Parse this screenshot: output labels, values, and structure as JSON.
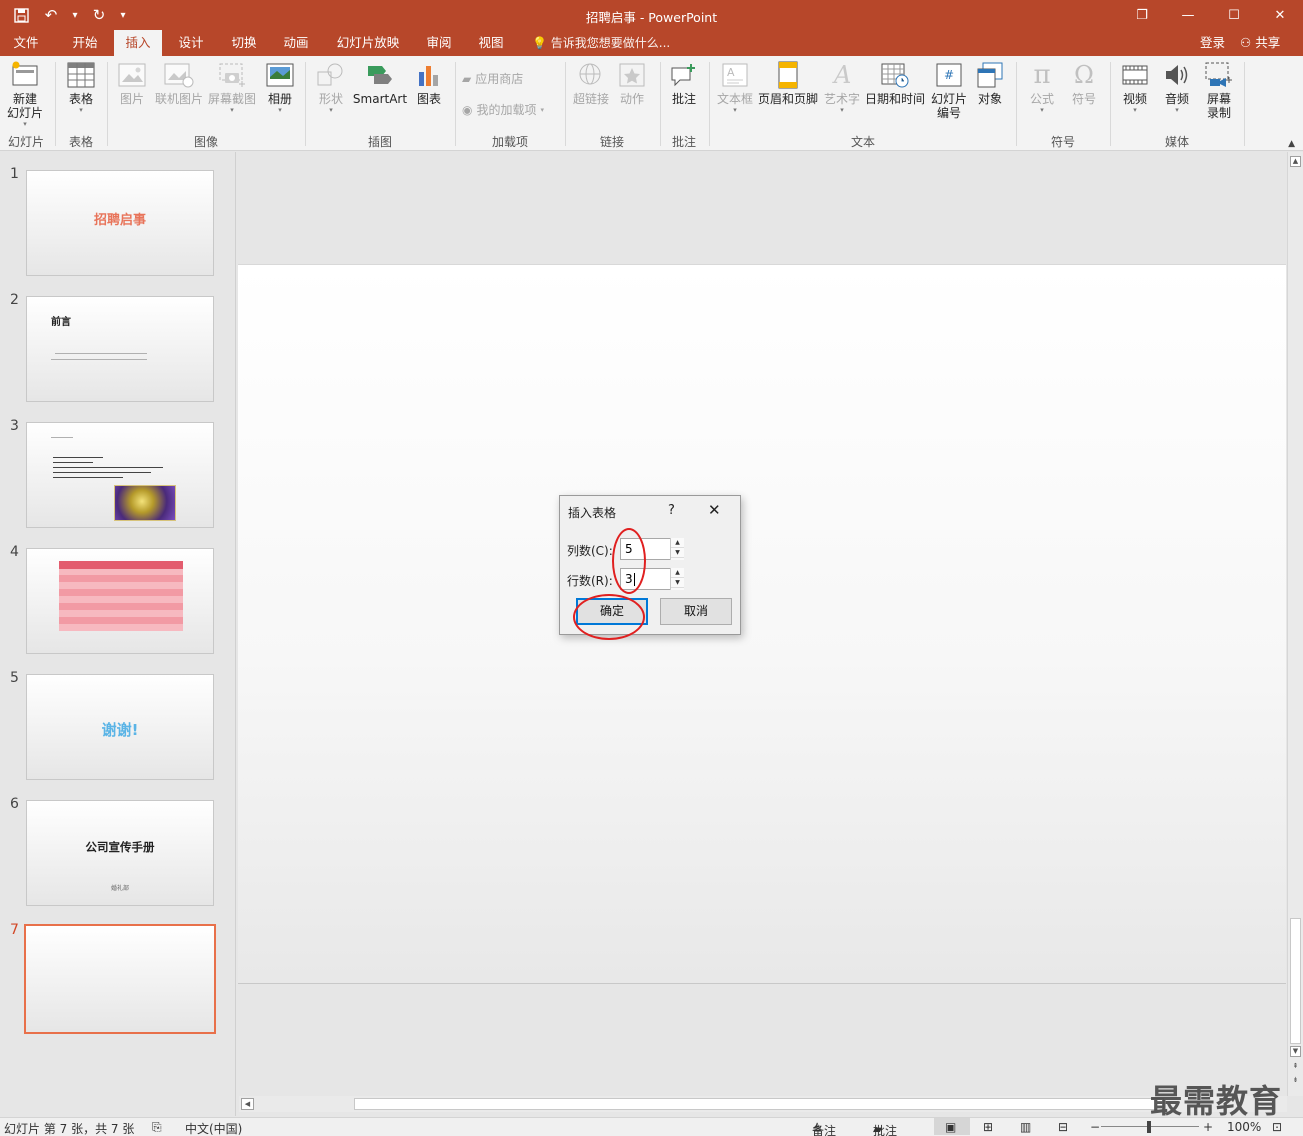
{
  "window": {
    "title": "招聘启事 - PowerPoint",
    "controls": [
      "❐",
      "—",
      "☐",
      "✕"
    ]
  },
  "tabs": [
    "文件",
    "开始",
    "插入",
    "设计",
    "切换",
    "动画",
    "幻灯片放映",
    "审阅",
    "视图"
  ],
  "active_tab": "插入",
  "tell_me": "告诉我您想要做什么...",
  "account": {
    "login": "登录",
    "share": "共享"
  },
  "ribbon": {
    "buttons": {
      "new_slide": "新建\n幻灯片",
      "table": "表格",
      "picture": "图片",
      "online_picture": "联机图片",
      "screenshot": "屏幕截图",
      "album": "相册",
      "shapes": "形状",
      "smartart": "SmartArt",
      "chart": "图表",
      "app_store": "应用商店",
      "my_addins": "我的加载项",
      "hyperlink": "超链接",
      "action": "动作",
      "comment": "批注",
      "textbox": "文本框",
      "header_footer": "页眉和页脚",
      "wordart": "艺术字",
      "datetime": "日期和时间",
      "slide_number": "幻灯片\n编号",
      "object": "对象",
      "equation": "公式",
      "symbol": "符号",
      "video": "视频",
      "audio": "音频",
      "screen_recording": "屏幕\n录制"
    },
    "groups": [
      "幻灯片",
      "表格",
      "图像",
      "插图",
      "加载项",
      "链接",
      "批注",
      "文本",
      "符号",
      "媒体"
    ]
  },
  "slides": [
    {
      "num": "1",
      "title": "招聘启事"
    },
    {
      "num": "2",
      "title": "前言"
    },
    {
      "num": "3",
      "title": ""
    },
    {
      "num": "4",
      "title": ""
    },
    {
      "num": "5",
      "title": "谢谢!"
    },
    {
      "num": "6",
      "title": "公司宣传手册",
      "subtitle": "婚礼部"
    },
    {
      "num": "7",
      "title": ""
    }
  ],
  "selected_slide": 7,
  "dialog": {
    "title": "插入表格",
    "help": "?",
    "close": "✕",
    "columns_label": "列数(C):",
    "columns_value": "5",
    "rows_label": "行数(R):",
    "rows_value": "3",
    "ok": "确定",
    "cancel": "取消"
  },
  "status": {
    "slide_info": "幻灯片 第 7 张，共 7 张",
    "language": "中文(中国)",
    "notes": "备注",
    "comments": "批注",
    "zoom": "100%"
  },
  "watermark": "最需教育",
  "colors": {
    "accent": "#b7472a",
    "selection": "#e8704a",
    "annotation": "#e02020",
    "default_button": "#0078d7"
  }
}
